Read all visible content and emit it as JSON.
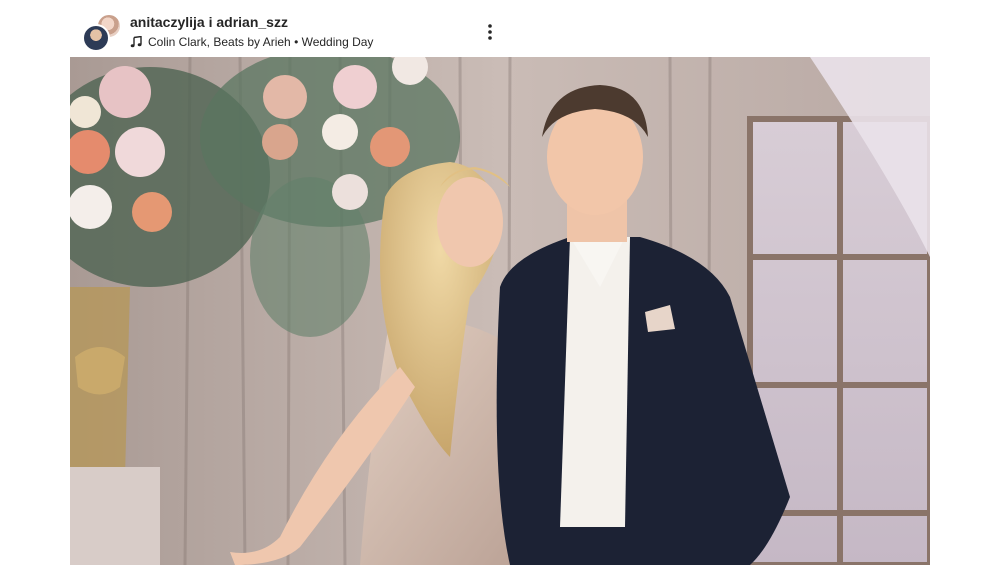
{
  "post": {
    "username": "anitaczylija i adrian_szz",
    "audio": "Colin Clark, Beats by Arieh • Wedding Day"
  },
  "icons": {
    "music": "music-note-icon",
    "more": "more-options-icon"
  },
  "colors": {
    "text": "#262626",
    "background": "#ffffff"
  }
}
